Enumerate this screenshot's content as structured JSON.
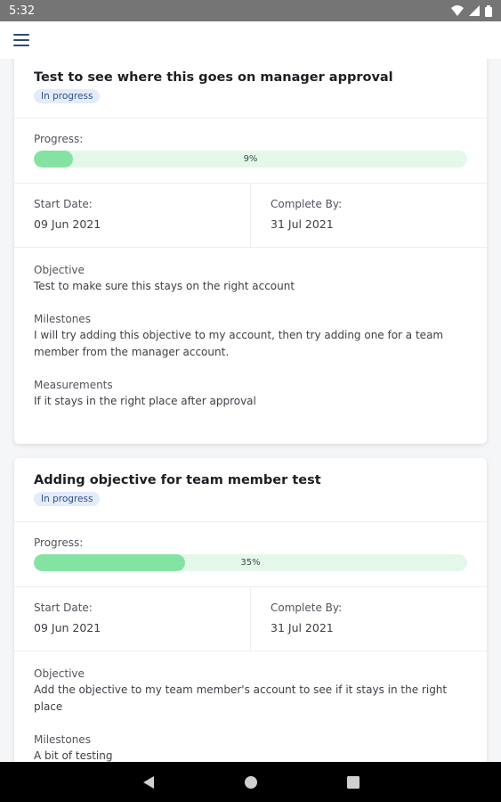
{
  "status_bar": {
    "time": "5:32"
  },
  "objectives": [
    {
      "title": "Test to see where this goes on manager approval",
      "status": "In progress",
      "progress_label": "Progress:",
      "progress_percent": 9,
      "progress_text": "9%",
      "start_label": "Start Date:",
      "start_date": "09 Jun 2021",
      "complete_label": "Complete By:",
      "complete_date": "31 Jul 2021",
      "objective_label": "Objective",
      "objective_text": "Test to make sure this stays on the right account",
      "milestones_label": "Milestones",
      "milestones_text": "I will try adding this objective to my account, then try adding one for a team member from the manager account.",
      "measurements_label": "Measurements",
      "measurements_text": "If it stays in the right place after approval"
    },
    {
      "title": "Adding objective for team member test",
      "status": "In progress",
      "progress_label": "Progress:",
      "progress_percent": 35,
      "progress_text": "35%",
      "start_label": "Start Date:",
      "start_date": "09 Jun 2021",
      "complete_label": "Complete By:",
      "complete_date": "31 Jul 2021",
      "objective_label": "Objective",
      "objective_text": "Add the objective to my team member's account to see if it stays in the right place",
      "milestones_label": "Milestones",
      "milestones_text": "A bit of testing"
    }
  ],
  "colors": {
    "progress_fill": "#84e3a2",
    "progress_track": "#e4f8ea",
    "badge_bg": "#e3ecfb",
    "badge_text": "#2f4f86",
    "menu_icon": "#2d4a77"
  },
  "icons": {
    "menu": "hamburger-menu-icon",
    "wifi": "wifi-icon",
    "signal": "cell-signal-icon",
    "battery": "battery-icon",
    "back": "back-triangle-icon",
    "home": "home-circle-icon",
    "recents": "recents-square-icon"
  }
}
